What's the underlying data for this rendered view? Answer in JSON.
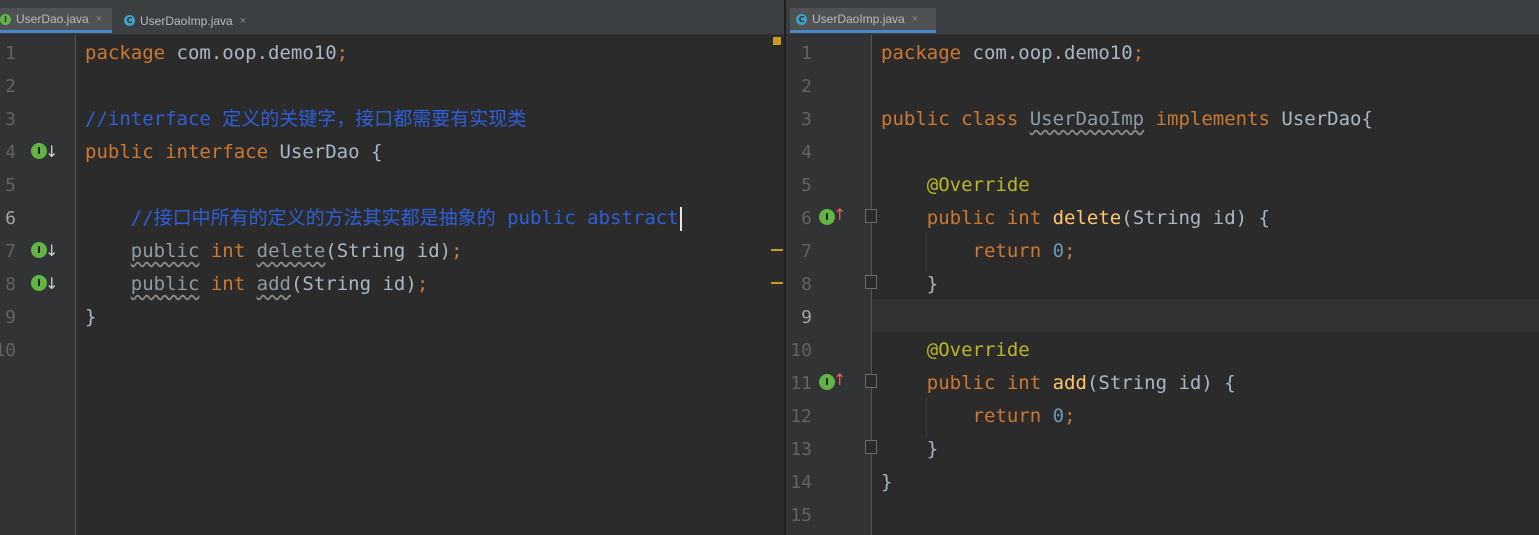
{
  "left_editor": {
    "tabs": [
      {
        "label": "UserDao.java",
        "icon": "interface-file-icon",
        "active": true,
        "close": "×"
      },
      {
        "label": "UserDaoImp.java",
        "icon": "class-file-icon",
        "active": false,
        "close": "×"
      }
    ],
    "gutter_icon_letter": "I",
    "lines": [
      {
        "num": "1",
        "text": "package com.oop.demo10;"
      },
      {
        "num": "2",
        "text": ""
      },
      {
        "num": "3",
        "text": "//interface 定义的关键字，接口都需要有实现类"
      },
      {
        "num": "4",
        "text": "public interface UserDao {"
      },
      {
        "num": "5",
        "text": ""
      },
      {
        "num": "6",
        "text": "    //接口中所有的定义的方法其实都是抽象的 public abstract"
      },
      {
        "num": "7",
        "text": "    public int delete(String id);"
      },
      {
        "num": "8",
        "text": "    public int add(String id);"
      },
      {
        "num": "9",
        "text": "}"
      },
      {
        "num": "10",
        "text": ""
      }
    ],
    "current_line": "6"
  },
  "right_editor": {
    "tabs": [
      {
        "label": "UserDaoImp.java",
        "icon": "class-file-icon",
        "active": true,
        "close": "×"
      }
    ],
    "gutter_icon_letter": "I",
    "lines": [
      {
        "num": "1",
        "text": "package com.oop.demo10;"
      },
      {
        "num": "2",
        "text": ""
      },
      {
        "num": "3",
        "text": "public class UserDaoImp implements UserDao{"
      },
      {
        "num": "4",
        "text": ""
      },
      {
        "num": "5",
        "text": "    @Override"
      },
      {
        "num": "6",
        "text": "    public int delete(String id) {"
      },
      {
        "num": "7",
        "text": "        return 0;"
      },
      {
        "num": "8",
        "text": "    }"
      },
      {
        "num": "9",
        "text": ""
      },
      {
        "num": "10",
        "text": "    @Override"
      },
      {
        "num": "11",
        "text": "    public int add(String id) {"
      },
      {
        "num": "12",
        "text": "        return 0;"
      },
      {
        "num": "13",
        "text": "    }"
      },
      {
        "num": "14",
        "text": "}"
      },
      {
        "num": "15",
        "text": ""
      }
    ],
    "current_line": "9"
  },
  "colors": {
    "editor_bg": "#2b2b2b",
    "keyword": "#cc7832",
    "comment": "#2f5fd8",
    "method_decl": "#ffc66d",
    "number": "#6897bb",
    "annotation": "#bbb529",
    "text": "#a9b7c6",
    "tab_active_underline": "#4a88c7"
  }
}
